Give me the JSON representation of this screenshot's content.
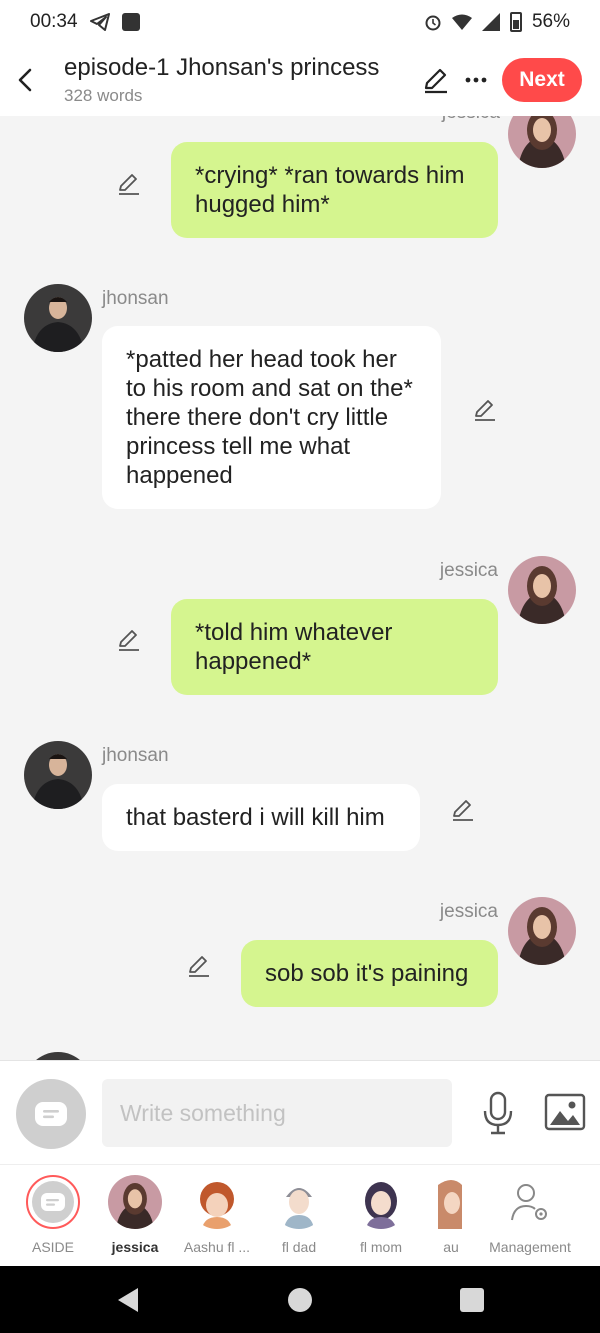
{
  "status": {
    "time": "00:34",
    "battery": "56%"
  },
  "header": {
    "title": "episode-1 Jhonsan's princess",
    "subtitle": "328 words",
    "next_label": "Next"
  },
  "messages": [
    {
      "name": "jessica",
      "text": "*crying* *ran towards him hugged him*"
    },
    {
      "name": "jhonsan",
      "text": "*patted her head took her to his room and sat on the* there there don't cry little princess tell me what happened"
    },
    {
      "name": "jessica",
      "text": "*told him whatever happened*"
    },
    {
      "name": "jhonsan",
      "text": "that basterd i will kill him"
    },
    {
      "name": "jessica",
      "text": "sob sob it's paining"
    }
  ],
  "composer": {
    "placeholder": "Write something"
  },
  "characters": [
    {
      "label": "ASIDE"
    },
    {
      "label": "jessica"
    },
    {
      "label": "Aashu fl ..."
    },
    {
      "label": "fl dad"
    },
    {
      "label": "fl mom"
    },
    {
      "label": "au"
    },
    {
      "label": "Management"
    }
  ],
  "colors": {
    "accent": "#ff4a4a",
    "my_bubble": "#d5f58f",
    "other_bubble": "#ffffff"
  }
}
